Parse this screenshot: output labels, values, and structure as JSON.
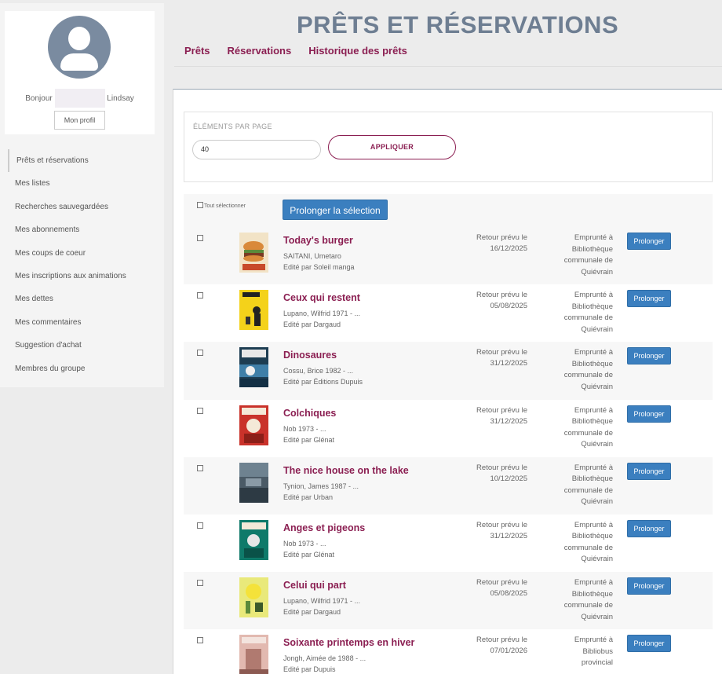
{
  "header": {
    "title": "PRÊTS ET RÉSERVATIONS",
    "tabs": [
      "Prêts",
      "Réservations",
      "Historique des prêts"
    ]
  },
  "profile": {
    "greeting_prefix": "Bonjour",
    "name": "Lindsay",
    "profile_button": "Mon profil"
  },
  "sidebar": {
    "items": [
      {
        "label": "Prêts et réservations"
      },
      {
        "label": "Mes listes"
      },
      {
        "label": "Recherches sauvegardées"
      },
      {
        "label": "Mes abonnements"
      },
      {
        "label": "Mes coups de coeur"
      },
      {
        "label": "Mes inscriptions aux animations"
      },
      {
        "label": "Mes dettes"
      },
      {
        "label": "Mes commentaires"
      },
      {
        "label": "Suggestion d'achat"
      },
      {
        "label": "Membres du groupe"
      }
    ]
  },
  "settings": {
    "items_per_page_label": "ÉLÉMENTS PAR PAGE",
    "items_per_page_value": "40",
    "apply_label": "APPLIQUER"
  },
  "list": {
    "select_all_label": "Tout sélectionner",
    "prolong_selection_label": "Prolonger la sélection",
    "prolong_label": "Prolonger",
    "loans": [
      {
        "title": "Today's burger",
        "author": "SAITANI, Umetaro",
        "publisher": "Edité par Soleil manga",
        "due_label": "Retour prévu le",
        "due_date": "16/12/2025",
        "loc": [
          "Emprunté à",
          "Bibliothèque",
          "communale de",
          "Quiévrain"
        ]
      },
      {
        "title": "Ceux qui restent",
        "author": "Lupano, Wilfrid 1971 - ...",
        "publisher": "Edité par Dargaud",
        "due_label": "Retour prévu le",
        "due_date": "05/08/2025",
        "loc": [
          "Emprunté à",
          "Bibliothèque",
          "communale de",
          "Quiévrain"
        ]
      },
      {
        "title": "Dinosaures",
        "author": "Cossu, Brice 1982 - ...",
        "publisher": "Edité par Éditions Dupuis",
        "due_label": "Retour prévu le",
        "due_date": "31/12/2025",
        "loc": [
          "Emprunté à",
          "Bibliothèque",
          "communale de",
          "Quiévrain"
        ]
      },
      {
        "title": "Colchiques",
        "author": "Nob 1973 - ...",
        "publisher": "Edité par Glénat",
        "due_label": "Retour prévu le",
        "due_date": "31/12/2025",
        "loc": [
          "Emprunté à",
          "Bibliothèque",
          "communale de",
          "Quiévrain"
        ]
      },
      {
        "title": "The nice house on the lake",
        "author": "Tynion, James 1987 - ...",
        "publisher": "Edité par Urban",
        "due_label": "Retour prévu le",
        "due_date": "10/12/2025",
        "loc": [
          "Emprunté à",
          "Bibliothèque",
          "communale de",
          "Quiévrain"
        ]
      },
      {
        "title": "Anges et pigeons",
        "author": "Nob 1973 - ...",
        "publisher": "Edité par Glénat",
        "due_label": "Retour prévu le",
        "due_date": "31/12/2025",
        "loc": [
          "Emprunté à",
          "Bibliothèque",
          "communale de",
          "Quiévrain"
        ]
      },
      {
        "title": "Celui qui part",
        "author": "Lupano, Wilfrid 1971 - ...",
        "publisher": "Edité par Dargaud",
        "due_label": "Retour prévu le",
        "due_date": "05/08/2025",
        "loc": [
          "Emprunté à",
          "Bibliothèque",
          "communale de",
          "Quiévrain"
        ]
      },
      {
        "title": "Soixante printemps en hiver",
        "author": "Jongh, Aimée de 1988 - ...",
        "publisher": "Edité par Dupuis",
        "due_label": "Retour prévu le",
        "due_date": "07/01/2026",
        "loc": [
          "Emprunté à",
          "Bibliobus provincial"
        ]
      }
    ]
  },
  "colors": {
    "brand": "#8b1f52",
    "button_blue": "#3b7fbf",
    "title_gray": "#6e7e92"
  }
}
